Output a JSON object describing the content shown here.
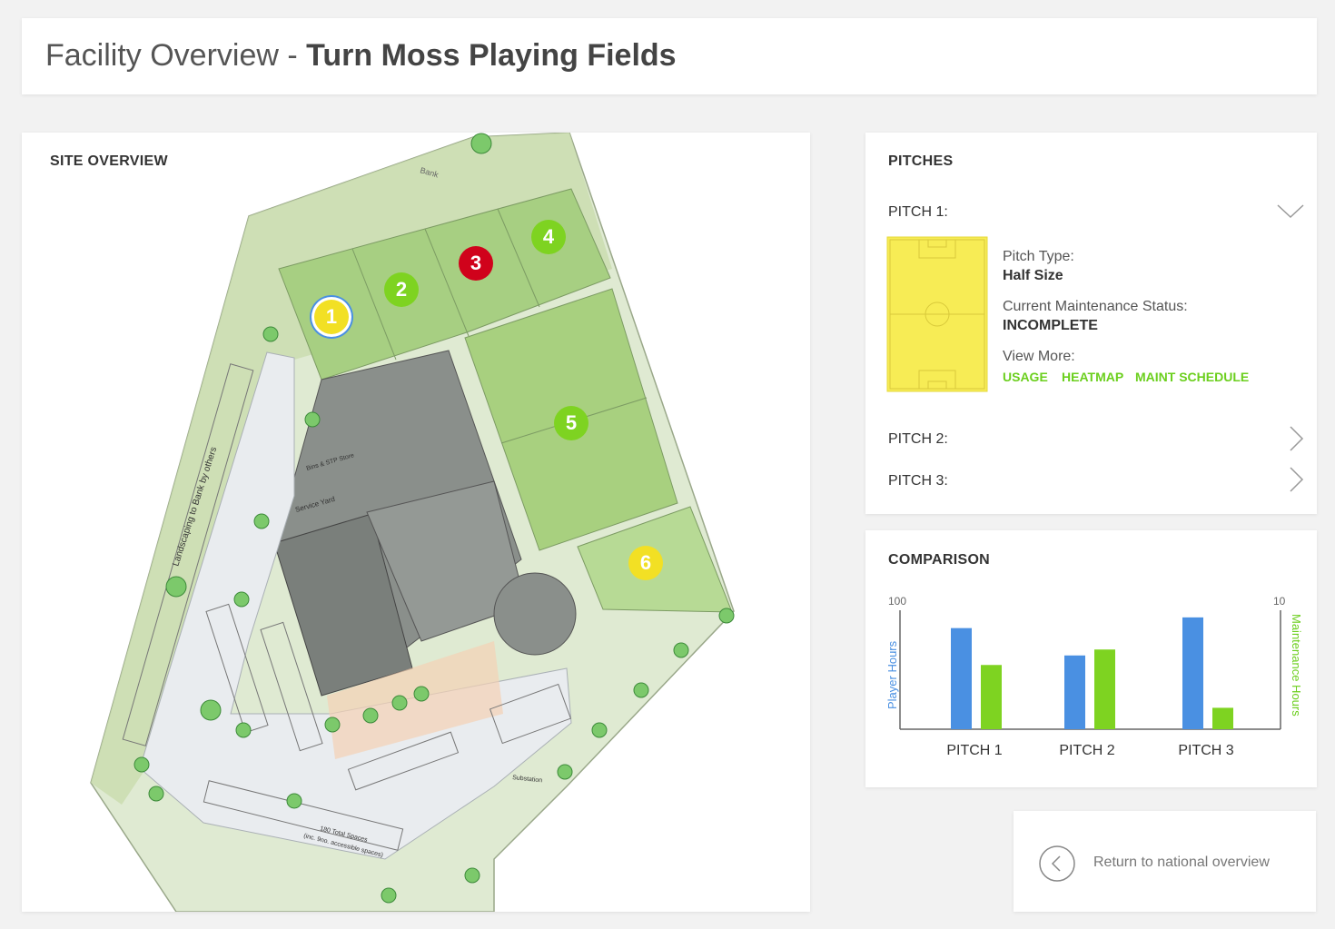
{
  "header": {
    "title_prefix": "Facility Overview - ",
    "title_name": "Turn Moss Playing Fields"
  },
  "site": {
    "title": "SITE OVERVIEW",
    "map_labels": {
      "bank": "Bank",
      "landscaping": "Landscaping to Bank by others",
      "bins": "Bins & STP Store",
      "service_yard": "Service Yard",
      "total_spaces": "180 Total Spaces",
      "accessible": "(inc. 9no. accessible spaces)",
      "substation": "Substation"
    },
    "markers": [
      {
        "label": "1",
        "color": "#f2e024",
        "selected": true
      },
      {
        "label": "2",
        "color": "#7ed321"
      },
      {
        "label": "3",
        "color": "#d0021b"
      },
      {
        "label": "4",
        "color": "#7ed321"
      },
      {
        "label": "5",
        "color": "#7ed321"
      },
      {
        "label": "6",
        "color": "#f2e024"
      }
    ]
  },
  "pitches": {
    "title": "PITCHES",
    "items": [
      {
        "label": "PITCH 1:",
        "expanded": true,
        "type_label": "Pitch Type:",
        "type_value": "Half Size",
        "status_label": "Current Maintenance Status:",
        "status_value": "INCOMPLETE",
        "more_label": "View More:",
        "links": [
          "USAGE",
          "HEATMAP",
          "MAINT SCHEDULE"
        ]
      },
      {
        "label": "PITCH 2:"
      },
      {
        "label": "PITCH 3:"
      }
    ]
  },
  "comparison": {
    "title": "COMPARISON",
    "left_max": "100",
    "right_max": "10",
    "left_axis_label": "Player Hours",
    "right_axis_label": "Maintenance Hours"
  },
  "chart_data": {
    "type": "bar",
    "categories": [
      "PITCH 1",
      "PITCH 2",
      "PITCH 3"
    ],
    "series": [
      {
        "axis": "left",
        "color": "#4a90e2",
        "values": [
          85,
          62,
          94
        ]
      },
      {
        "axis": "right",
        "color": "#7ed321",
        "values": [
          5.4,
          6.7,
          1.8
        ]
      }
    ],
    "ylabel": "Player Hours",
    "y2label": "Maintenance Hours",
    "ylim": [
      0,
      100
    ],
    "y2lim": [
      0,
      10
    ]
  },
  "colors": {
    "accent_green": "#6bcf1d",
    "accent_blue": "#4a90e2",
    "pitch_yellow": "#f7ec55"
  },
  "return": {
    "label": "Return to national overview",
    "icon": "chevron-left-circle-icon"
  }
}
